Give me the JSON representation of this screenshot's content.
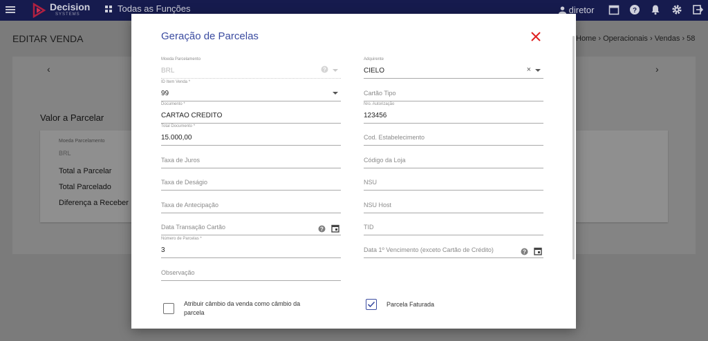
{
  "topbar": {
    "brand": "Decision",
    "brand_sub": "SYSTEMS",
    "all_functions": "Todas as Funções",
    "user": "diretor"
  },
  "page": {
    "title": "EDITAR VENDA",
    "breadcrumb": "Home › Operacionais › Vendas › 58",
    "section_title": "Valor a Parcelar",
    "currency_label": "Moeda Parcelamento",
    "currency_value": "BRL",
    "total_parcelar": "Total a Parcelar",
    "total_parcelado": "Total Parcelado",
    "diferenca": "Diferença a Receber"
  },
  "modal": {
    "title": "Geração de Parcelas",
    "left": {
      "moeda_label": "Moeda Parcelamento",
      "moeda_value": "BRL",
      "id_item_label": "ID Item Venda  *",
      "id_item_value": "99",
      "documento_label": "Documento  *",
      "documento_value": "CARTAO CREDITO",
      "total_doc_label": "Total Documento  *",
      "total_doc_value": "15.000,00",
      "taxa_juros": "Taxa de Juros",
      "taxa_desagio": "Taxa de Deságio",
      "taxa_antecipacao": "Taxa de Antecipação",
      "data_transacao": "Data Transação Cartão",
      "num_parcelas_label": "Número de Parcelas  *",
      "num_parcelas_value": "3",
      "observacao": "Observação"
    },
    "right": {
      "adquirente_label": "Adquirente",
      "adquirente_value": "CIELO",
      "cartao_tipo": "Cartão Tipo",
      "nro_autorizacao_label": "Nro. Autorização",
      "nro_autorizacao_value": "123456",
      "cod_estabelecimento": "Cod. Estabelecimento",
      "codigo_loja": "Código da Loja",
      "nsu": "NSU",
      "nsu_host": "NSU Host",
      "tid": "TID",
      "data_vencimento": "Data 1º Vencimento (exceto Cartão de Crédito)"
    },
    "checkboxes": {
      "atribuir_line1": "Atribuir câmbio da venda como câmbio da",
      "atribuir_line2": "parcela",
      "atribuir_checked": false,
      "faturada": "Parcela Faturada",
      "faturada_checked": true
    }
  },
  "colors": {
    "topbar": "#161b4e",
    "accent": "#3a4ba0",
    "close": "#e02020"
  }
}
